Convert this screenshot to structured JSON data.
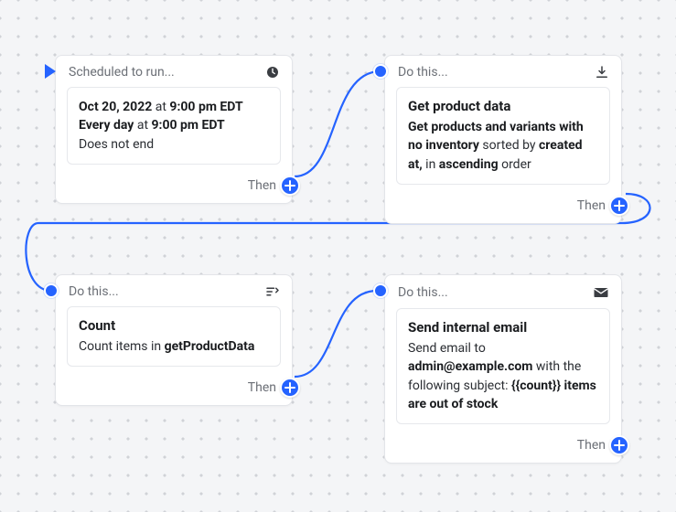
{
  "card1": {
    "header": "Scheduled to run...",
    "then": "Then",
    "body": {
      "line1_prefix": "Oct 20, 2022",
      "line1_at": " at ",
      "line1_time": "9:00 pm EDT",
      "line2_prefix": "Every day",
      "line2_at": " at ",
      "line2_time": "9:00 pm EDT",
      "line3": "Does not end"
    }
  },
  "card2": {
    "header": "Do this...",
    "then": "Then",
    "title": "Get product data",
    "body": {
      "t1": "Get products and variants with ",
      "b1": "no inventory",
      "t2": " sorted by ",
      "b2": "created at,",
      "t3": " in ",
      "b3": "ascending",
      "t4": " order"
    }
  },
  "card3": {
    "header": "Do this...",
    "then": "Then",
    "title": "Count",
    "body": {
      "t1": "Count items in ",
      "b1": "getProductData"
    }
  },
  "card4": {
    "header": "Do this...",
    "then": "Then",
    "title": "Send internal email",
    "body": {
      "t1": "Send email to ",
      "b1": "admin@example.com",
      "t2": " with the following subject: ",
      "b2": "{{count}} items are out of stock"
    }
  }
}
